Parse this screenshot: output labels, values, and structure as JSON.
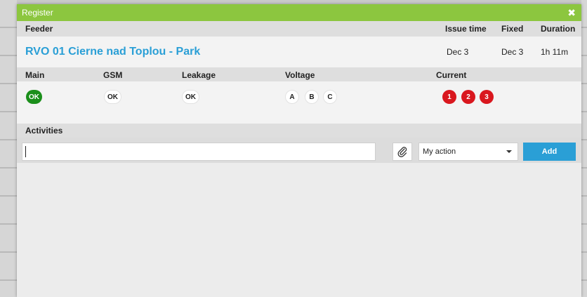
{
  "dialog": {
    "title": "Register",
    "close_icon": "close-icon",
    "accent_color": "#8cc63f"
  },
  "header": {
    "feeder_label": "Feeder",
    "issue_time_label": "Issue time",
    "fixed_label": "Fixed",
    "duration_label": "Duration"
  },
  "feeder": {
    "name": "RVO 01 Cierne nad Toplou - Park",
    "issue_time": "Dec 3",
    "fixed": "Dec 3",
    "duration": "1h 11m",
    "name_color": "#2a9fd6"
  },
  "status_headers": {
    "main": "Main",
    "gsm": "GSM",
    "leakage": "Leakage",
    "voltage": "Voltage",
    "current": "Current"
  },
  "status": {
    "main": "OK",
    "gsm": "OK",
    "leakage": "OK",
    "voltage": [
      "A",
      "B",
      "C"
    ],
    "current": [
      "1",
      "2",
      "3"
    ],
    "ok_color": "#1b8f1b",
    "alarm_color": "#d9171e"
  },
  "activities": {
    "label": "Activities",
    "input_value": "",
    "attach_icon": "paperclip-icon",
    "action_select": "My action",
    "add_label": "Add"
  }
}
